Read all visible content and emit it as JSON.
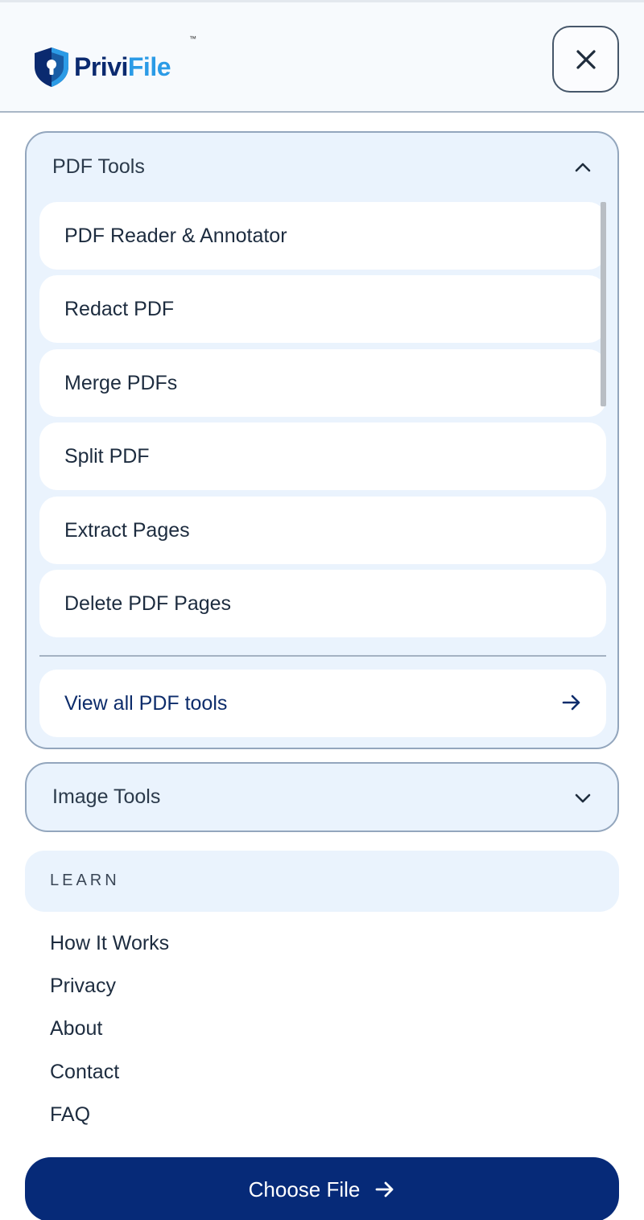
{
  "brand": {
    "name_part1": "Privi",
    "name_part2": "File",
    "trademark": "™"
  },
  "header": {
    "close_icon": "close-icon"
  },
  "pdf_tools": {
    "title": "PDF Tools",
    "expanded": true,
    "items": [
      {
        "label": "PDF Reader & Annotator"
      },
      {
        "label": "Redact PDF"
      },
      {
        "label": "Merge PDFs"
      },
      {
        "label": "Split PDF"
      },
      {
        "label": "Extract Pages"
      },
      {
        "label": "Delete PDF Pages"
      }
    ],
    "view_all_label": "View all PDF tools"
  },
  "image_tools": {
    "title": "Image Tools",
    "expanded": false
  },
  "learn": {
    "label": "LEARN",
    "links": [
      "How It Works",
      "Privacy",
      "About",
      "Contact",
      "FAQ"
    ]
  },
  "cta": {
    "label": "Choose File"
  },
  "colors": {
    "brand_dark": "#0b2a6f",
    "brand_light": "#2b9be6",
    "panel_bg": "#eaf3fd",
    "cta_bg": "#062a78"
  }
}
